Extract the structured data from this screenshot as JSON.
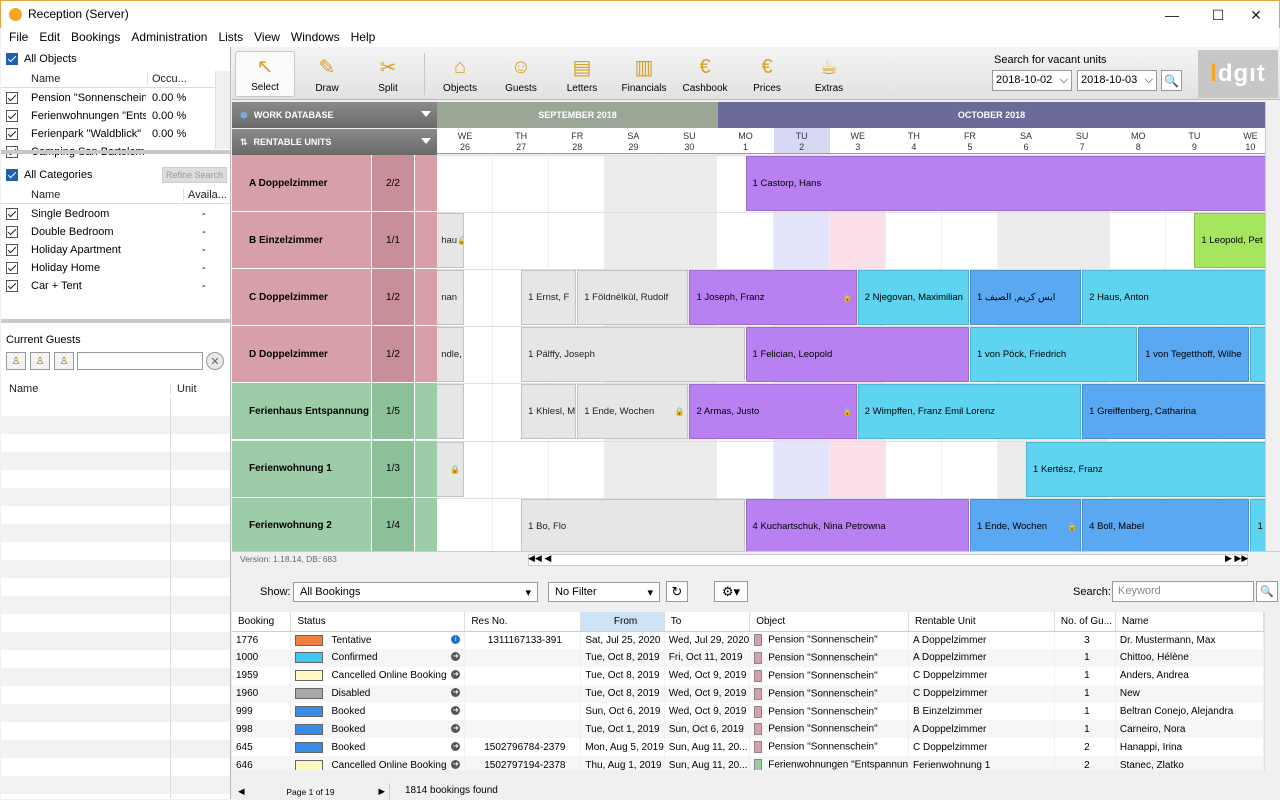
{
  "window": {
    "title": "Reception (Server)",
    "minimize": "—",
    "maximize": "☐",
    "close": "✕"
  },
  "menu": [
    "File",
    "Edit",
    "Bookings",
    "Administration",
    "Lists",
    "View",
    "Windows",
    "Help"
  ],
  "objects": {
    "header": "All Objects",
    "col_name": "Name",
    "col_occ": "Occu...",
    "rows": [
      {
        "name": "Pension \"Sonnenschein\"",
        "occ": "0.00 %"
      },
      {
        "name": "Ferienwohnungen \"Entspannu...",
        "occ": "0.00 %"
      },
      {
        "name": "Ferienpark \"Waldblick\"",
        "occ": "0.00 %"
      },
      {
        "name": "Camping San Bartolomeo",
        "occ": ""
      }
    ]
  },
  "categories": {
    "header": "All Categories",
    "refine": "Refine Search",
    "col_name": "Name",
    "col_avail": "Availa...",
    "rows": [
      {
        "name": "Single Bedroom",
        "avail": "-"
      },
      {
        "name": "Double Bedroom",
        "avail": "-"
      },
      {
        "name": "Holiday Apartment",
        "avail": "-"
      },
      {
        "name": "Holiday Home",
        "avail": "-"
      },
      {
        "name": "Car + Tent",
        "avail": "-"
      }
    ]
  },
  "guests": {
    "header": "Current Guests",
    "col_name": "Name",
    "col_unit": "Unit"
  },
  "toolbar": {
    "tools": [
      {
        "label": "Select",
        "icon": "cursor-icon"
      },
      {
        "label": "Draw",
        "icon": "pencil-icon"
      },
      {
        "label": "Split",
        "icon": "scissors-icon"
      },
      {
        "label": "Objects",
        "icon": "house-icon"
      },
      {
        "label": "Guests",
        "icon": "guests-icon"
      },
      {
        "label": "Letters",
        "icon": "letters-icon"
      },
      {
        "label": "Financials",
        "icon": "financials-icon"
      },
      {
        "label": "Cashbook",
        "icon": "cashbook-icon"
      },
      {
        "label": "Prices",
        "icon": "prices-icon"
      },
      {
        "label": "Extras",
        "icon": "extras-icon"
      }
    ],
    "search_label": "Search for vacant units",
    "date_from": "2018-10-02",
    "date_to": "2018-10-03"
  },
  "logo": {
    "text": "dgıt",
    "accent": "l"
  },
  "planner": {
    "work_db": "WORK DATABASE",
    "rentable": "RENTABLE UNITS",
    "months": [
      "SEPTEMBER 2018",
      "OCTOBER 2018"
    ],
    "days": [
      {
        "dow": "WE",
        "d": "26"
      },
      {
        "dow": "TH",
        "d": "27"
      },
      {
        "dow": "FR",
        "d": "28"
      },
      {
        "dow": "SA",
        "d": "29"
      },
      {
        "dow": "SU",
        "d": "30"
      },
      {
        "dow": "MO",
        "d": "1"
      },
      {
        "dow": "TU",
        "d": "2"
      },
      {
        "dow": "WE",
        "d": "3"
      },
      {
        "dow": "TH",
        "d": "4"
      },
      {
        "dow": "FR",
        "d": "5"
      },
      {
        "dow": "SA",
        "d": "6"
      },
      {
        "dow": "SU",
        "d": "7"
      },
      {
        "dow": "MO",
        "d": "8"
      },
      {
        "dow": "TU",
        "d": "9"
      },
      {
        "dow": "WE",
        "d": "10"
      }
    ],
    "units": [
      {
        "name": "A Doppelzimmer",
        "count": "2/2"
      },
      {
        "name": "B Einzelzimmer",
        "count": "1/1"
      },
      {
        "name": "C Doppelzimmer",
        "count": "1/2"
      },
      {
        "name": "D Doppelzimmer",
        "count": "1/2"
      },
      {
        "name": "Ferienhaus Entspannung",
        "count": "1/5"
      },
      {
        "name": "Ferienwohnung 1",
        "count": "1/3"
      },
      {
        "name": "Ferienwohnung 2",
        "count": "1/4"
      }
    ],
    "bookings": [
      {
        "row": 0,
        "start": 5.5,
        "end": 15,
        "text": "1 Castorp, Hans",
        "color": "violet"
      },
      {
        "row": 1,
        "start": -0.5,
        "end": 0.5,
        "text": "hau",
        "color": "gray",
        "lock": true
      },
      {
        "row": 1,
        "start": 13.5,
        "end": 15,
        "text": "1 Leopold, Pet",
        "color": "lime"
      },
      {
        "row": 2,
        "start": -0.5,
        "end": 0.5,
        "text": "nan",
        "color": "gray"
      },
      {
        "row": 2,
        "start": 1.5,
        "end": 2.5,
        "text": "1 Ernst, F",
        "color": "gray"
      },
      {
        "row": 2,
        "start": 2.5,
        "end": 4.5,
        "text": "1 Földnélkül, Rudolf",
        "color": "gray"
      },
      {
        "row": 2,
        "start": 4.5,
        "end": 7.5,
        "text": "1 Joseph, Franz",
        "color": "violet",
        "lock": true
      },
      {
        "row": 2,
        "start": 7.5,
        "end": 9.5,
        "text": "2 Njegovan, Maximilian",
        "color": "cyan"
      },
      {
        "row": 2,
        "start": 9.5,
        "end": 11.5,
        "text": "1 ایس کریم, الصیف",
        "color": "blueb"
      },
      {
        "row": 2,
        "start": 11.5,
        "end": 15,
        "text": "2 Haus, Anton",
        "color": "cyan"
      },
      {
        "row": 3,
        "start": -0.5,
        "end": 0.5,
        "text": "ndle,",
        "color": "gray"
      },
      {
        "row": 3,
        "start": 1.5,
        "end": 5.5,
        "text": "1 Pálffy, Joseph",
        "color": "gray"
      },
      {
        "row": 3,
        "start": 5.5,
        "end": 9.5,
        "text": "1 Felician, Leopold",
        "color": "violet"
      },
      {
        "row": 3,
        "start": 9.5,
        "end": 12.5,
        "text": "1 von Pöck, Friedrich",
        "color": "cyan"
      },
      {
        "row": 3,
        "start": 12.5,
        "end": 14.5,
        "text": "1 von Tegetthoff, Wilhe",
        "color": "blueb"
      },
      {
        "row": 3,
        "start": 14.5,
        "end": 15,
        "text": "",
        "color": "cyan"
      },
      {
        "row": 4,
        "start": -0.5,
        "end": 0.5,
        "text": "",
        "color": "gray"
      },
      {
        "row": 4,
        "start": 1.5,
        "end": 2.5,
        "text": "1 Khlesl, M",
        "color": "gray"
      },
      {
        "row": 4,
        "start": 2.5,
        "end": 4.5,
        "text": "1 Ende, Wochen",
        "color": "gray",
        "lock": true
      },
      {
        "row": 4,
        "start": 4.5,
        "end": 7.5,
        "text": "2 Armas, Justo",
        "color": "violet",
        "lock": true
      },
      {
        "row": 4,
        "start": 7.5,
        "end": 11.5,
        "text": "2 Wimpffen, Franz Emil Lorenz",
        "color": "cyan"
      },
      {
        "row": 4,
        "start": 11.5,
        "end": 15,
        "text": "1 Greiffenberg, Catharina",
        "color": "blueb"
      },
      {
        "row": 5,
        "start": -0.5,
        "end": 0.5,
        "text": "",
        "color": "gray",
        "lock": true
      },
      {
        "row": 5,
        "start": 10.5,
        "end": 15,
        "text": "1 Kertész, Franz",
        "color": "cyan"
      },
      {
        "row": 6,
        "start": 1.5,
        "end": 5.5,
        "text": "1 Bo, Flo",
        "color": "gray"
      },
      {
        "row": 6,
        "start": 5.5,
        "end": 9.5,
        "text": "4 Kuchartschuk, Nina Petrowna",
        "color": "violet"
      },
      {
        "row": 6,
        "start": 9.5,
        "end": 11.5,
        "text": "1 Ende, Wochen",
        "color": "blueb",
        "lock": true
      },
      {
        "row": 6,
        "start": 11.5,
        "end": 14.5,
        "text": "4 Boll, Mabel",
        "color": "blueb"
      },
      {
        "row": 6,
        "start": 14.5,
        "end": 15,
        "text": "1",
        "color": "cyan"
      }
    ],
    "version": "Version: 1.18.14, DB: 683"
  },
  "list": {
    "show_label": "Show:",
    "show_value": "All Bookings",
    "filter_value": "No Filter",
    "search_label": "Search:",
    "keyword_placeholder": "Keyword",
    "columns": [
      "Booking",
      "Status",
      "Res No.",
      "From",
      "To",
      "Object",
      "Rentable Unit",
      "No. of Gu...",
      "Name"
    ],
    "rows": [
      {
        "booking": "1776",
        "status": "Tentative",
        "scolor": "#f08040",
        "res": "1311167133-391",
        "from": "Sat, Jul 25, 2020",
        "to": "Wed, Jul 29, 2020",
        "object": "Pension \"Sonnenschein\"",
        "ocolor": "#d7a0a8",
        "unit": "A Doppelzimmer",
        "guests": "3",
        "name": "Dr. Mustermann, Max",
        "icon": "i"
      },
      {
        "booking": "1000",
        "status": "Confirmed",
        "scolor": "#40c8f0",
        "res": "",
        "from": "Tue, Oct 8, 2019",
        "to": "Fri, Oct 11, 2019",
        "object": "Pension \"Sonnenschein\"",
        "ocolor": "#d7a0a8",
        "unit": "A Doppelzimmer",
        "guests": "1",
        "name": "Chittoo, Hélène",
        "icon": "→"
      },
      {
        "booking": "1959",
        "status": "Cancelled Online Booking",
        "scolor": "#fff8c0",
        "res": "",
        "from": "Tue, Oct 8, 2019",
        "to": "Wed, Oct 9, 2019",
        "object": "Pension \"Sonnenschein\"",
        "ocolor": "#d7a0a8",
        "unit": "C Doppelzimmer",
        "guests": "1",
        "name": "Anders, Andrea",
        "icon": "→"
      },
      {
        "booking": "1960",
        "status": "Disabled",
        "scolor": "#a8a8a8",
        "res": "",
        "from": "Tue, Oct 8, 2019",
        "to": "Wed, Oct 9, 2019",
        "object": "Pension \"Sonnenschein\"",
        "ocolor": "#d7a0a8",
        "unit": "C Doppelzimmer",
        "guests": "1",
        "name": "New",
        "icon": "→"
      },
      {
        "booking": "999",
        "status": "Booked",
        "scolor": "#3a8ae8",
        "res": "",
        "from": "Sun, Oct 6, 2019",
        "to": "Wed, Oct 9, 2019",
        "object": "Pension \"Sonnenschein\"",
        "ocolor": "#d7a0a8",
        "unit": "B Einzelzimmer",
        "guests": "1",
        "name": "Beltran Conejo, Alejandra",
        "icon": "→"
      },
      {
        "booking": "998",
        "status": "Booked",
        "scolor": "#3a8ae8",
        "res": "",
        "from": "Tue, Oct 1, 2019",
        "to": "Sun, Oct 6, 2019",
        "object": "Pension \"Sonnenschein\"",
        "ocolor": "#d7a0a8",
        "unit": "A Doppelzimmer",
        "guests": "1",
        "name": "Carneiro, Nora",
        "icon": "→"
      },
      {
        "booking": "645",
        "status": "Booked",
        "scolor": "#3a8ae8",
        "res": "1502796784-2379",
        "from": "Mon, Aug 5, 2019",
        "to": "Sun, Aug 11, 20...",
        "object": "Pension \"Sonnenschein\"",
        "ocolor": "#d7a0a8",
        "unit": "C Doppelzimmer",
        "guests": "2",
        "name": "Hanappi, Irina",
        "icon": "→"
      },
      {
        "booking": "646",
        "status": "Cancelled Online Booking",
        "scolor": "#fff8c0",
        "res": "1502797194-2378",
        "from": "Thu, Aug 1, 2019",
        "to": "Sun, Aug 11, 20...",
        "object": "Ferienwohnungen \"Entspannun",
        "ocolor": "#9dcca8",
        "unit": "Ferienwohnung 1",
        "guests": "2",
        "name": "Stanec, Zlatko",
        "icon": "→"
      }
    ],
    "page": "Page 1 of 19",
    "found": "1814 bookings found"
  }
}
